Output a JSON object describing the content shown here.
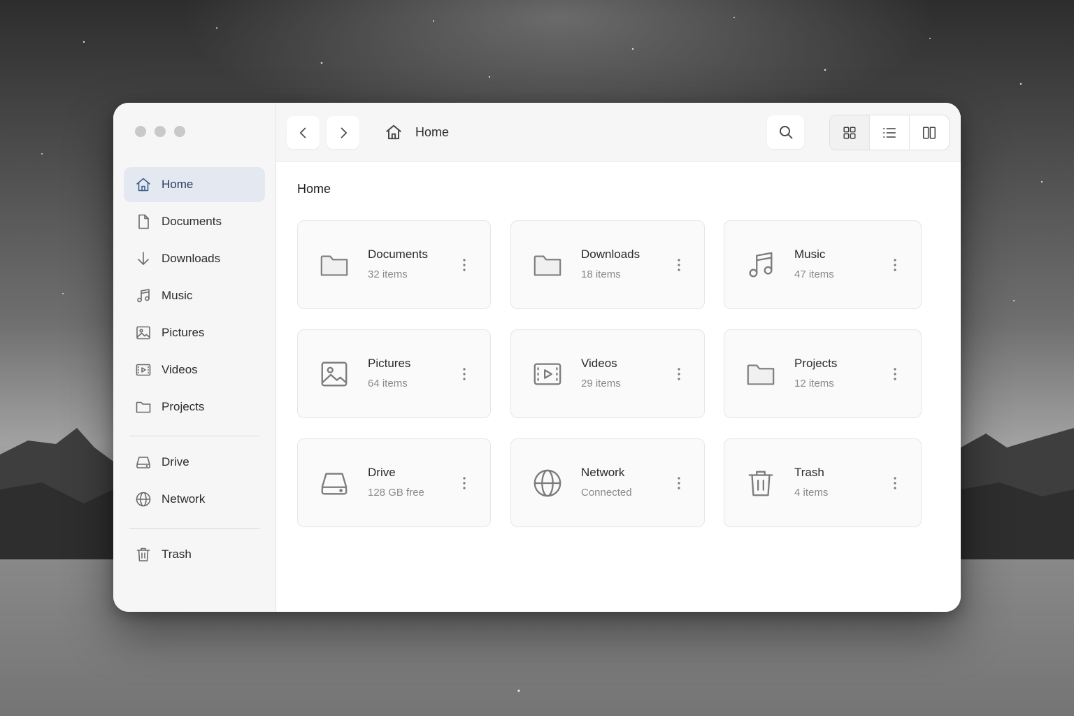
{
  "window": {
    "traffic_lights": [
      "close",
      "minimize",
      "maximize"
    ]
  },
  "sidebar": {
    "items": [
      {
        "label": "Home",
        "icon": "home-icon",
        "active": true
      },
      {
        "label": "Documents",
        "icon": "document-icon"
      },
      {
        "label": "Downloads",
        "icon": "download-arrow-icon"
      },
      {
        "label": "Music",
        "icon": "music-note-icon"
      },
      {
        "label": "Pictures",
        "icon": "image-icon"
      },
      {
        "label": "Videos",
        "icon": "video-icon"
      },
      {
        "label": "Projects",
        "icon": "folder-icon"
      }
    ],
    "devices": [
      {
        "label": "Drive",
        "icon": "drive-icon"
      },
      {
        "label": "Network",
        "icon": "globe-icon"
      }
    ],
    "trash": {
      "label": "Trash",
      "icon": "trash-icon"
    }
  },
  "toolbar": {
    "back_icon": "chevron-left-icon",
    "forward_icon": "chevron-right-icon",
    "breadcrumb": "Home",
    "breadcrumb_icon": "home-icon",
    "search_icon": "search-icon",
    "view_modes": [
      "grid-view-icon",
      "list-view-icon",
      "columns-view-icon"
    ],
    "active_view": "grid"
  },
  "main": {
    "title": "Home",
    "cards": [
      {
        "name": "Documents",
        "sub": "32 items",
        "icon": "folder-icon"
      },
      {
        "name": "Downloads",
        "sub": "18 items",
        "icon": "folder-icon"
      },
      {
        "name": "Music",
        "sub": "47 items",
        "icon": "music-note-icon"
      },
      {
        "name": "Pictures",
        "sub": "64 items",
        "icon": "image-icon"
      },
      {
        "name": "Videos",
        "sub": "29 items",
        "icon": "video-icon"
      },
      {
        "name": "Projects",
        "sub": "12 items",
        "icon": "folder-icon"
      },
      {
        "name": "Drive",
        "sub": "128 GB free",
        "icon": "drive-icon"
      },
      {
        "name": "Network",
        "sub": "Connected",
        "icon": "globe-icon"
      },
      {
        "name": "Trash",
        "sub": "4 items",
        "icon": "trash-icon"
      }
    ]
  },
  "colors": {
    "active_item_bg": "#e4e9f1",
    "active_item_text": "#27405f",
    "sidebar_bg": "#f6f6f6"
  }
}
